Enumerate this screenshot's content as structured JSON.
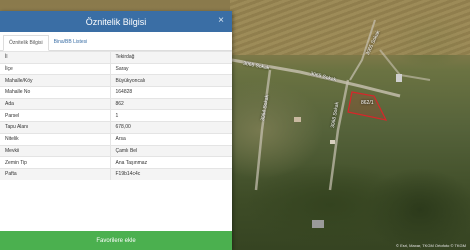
{
  "panel": {
    "title": "Öznitelik Bilgisi",
    "close_label": "×",
    "tabs": [
      {
        "label": "Öznitelik Bilgisi"
      },
      {
        "label": "Bina/BB Listesi"
      }
    ],
    "rows": [
      {
        "key": "İl",
        "value": "Tekirdağ"
      },
      {
        "key": "İlçe",
        "value": "Saray"
      },
      {
        "key": "Mahalle/Köy",
        "value": "Büyükyoncalı"
      },
      {
        "key": "Mahalle No",
        "value": "164828"
      },
      {
        "key": "Ada",
        "value": "862"
      },
      {
        "key": "Parsel",
        "value": "1"
      },
      {
        "key": "Tapu Alanı",
        "value": "678,00"
      },
      {
        "key": "Nitelik",
        "value": "Arsa"
      },
      {
        "key": "Mevkii",
        "value": "Çamlı Bel"
      },
      {
        "key": "Zemin Tip",
        "value": "Ana Taşınmaz"
      },
      {
        "key": "Pafta",
        "value": "F19b14c4c"
      }
    ],
    "favorite_button": "Favorilere ekle"
  },
  "map": {
    "road_labels": [
      "3065 Sokak",
      "3065 Sokak",
      "3065 Sokak",
      "3064 Sokak",
      "3068 Sokak"
    ],
    "parcel_label": "862/1",
    "attribution": "© Esri, Maxar, TKGM Ortofoto © TKGM"
  },
  "colors": {
    "header": "#3a6ea5",
    "favorite_button": "#4bb04f",
    "parcel_outline": "#d8262a"
  }
}
